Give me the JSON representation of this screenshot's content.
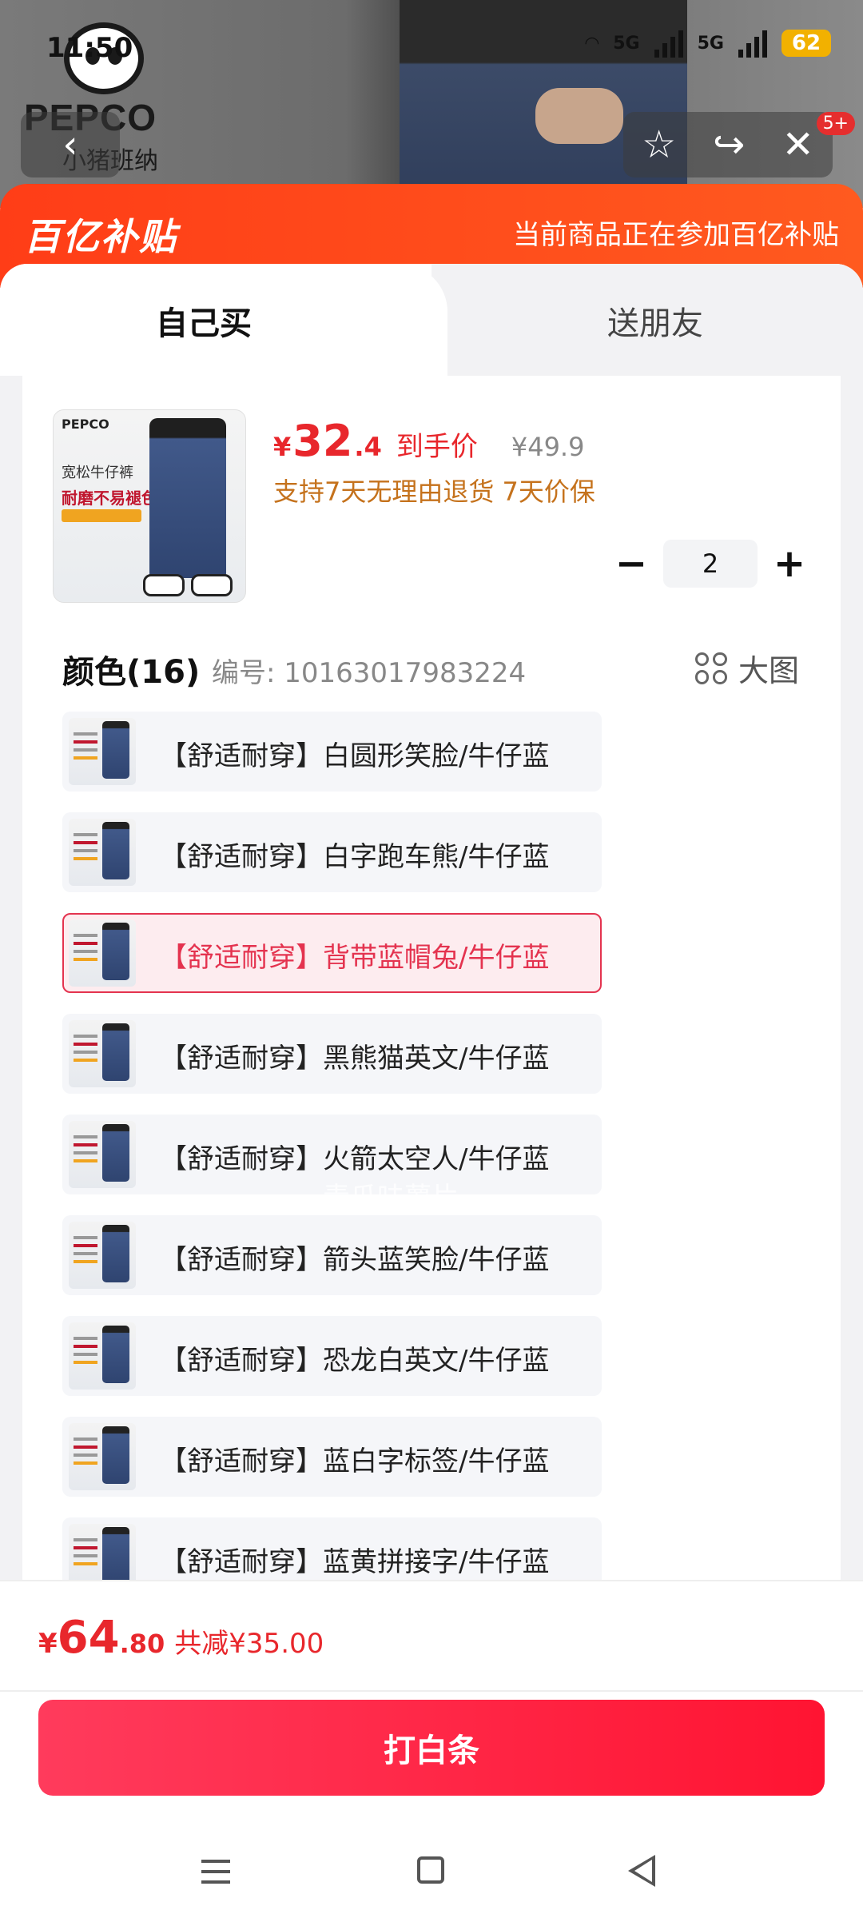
{
  "status_bar": {
    "time": "11:50",
    "signal_1": "5G",
    "signal_2": "5G",
    "battery": "62"
  },
  "background": {
    "brand": "PEPCO",
    "brand_cn": "小猪班纳",
    "notification_badge": "5+"
  },
  "banner": {
    "logo_text": "百亿补贴",
    "message": "当前商品正在参加百亿补贴"
  },
  "tabs": [
    {
      "label": "自己买",
      "active": true
    },
    {
      "label": "送朋友",
      "active": false
    }
  ],
  "product": {
    "thumb_brand": "PEPCO",
    "thumb_line1": "宽松牛仔裤",
    "thumb_line2": "耐磨不易褪色",
    "price_symbol": "¥",
    "price_integer": "32",
    "price_decimal": ".4",
    "price_label": "到手价",
    "original_price": "¥49.9",
    "services": "支持7天无理由退货 7天价保",
    "quantity": "2"
  },
  "colors": {
    "title": "颜色(16)",
    "code": "编号: 10163017983224",
    "big_pic_label": "大图",
    "selected_index": 2,
    "options": [
      "【舒适耐穿】白圆形笑脸/牛仔蓝",
      "【舒适耐穿】白字跑车熊/牛仔蓝",
      "【舒适耐穿】背带蓝帽兔/牛仔蓝",
      "【舒适耐穿】黑熊猫英文/牛仔蓝",
      "【舒适耐穿】火箭太空人/牛仔蓝",
      "【舒适耐穿】箭头蓝笑脸/牛仔蓝",
      "【舒适耐穿】恐龙白英文/牛仔蓝",
      "【舒适耐穿】蓝白字标签/牛仔蓝",
      "【舒适耐穿】蓝黄拼接字/牛仔蓝"
    ]
  },
  "watermark": "青瓜味薯片",
  "footer": {
    "total_symbol": "¥",
    "total_integer": "64",
    "total_decimal": ".80",
    "discount": "共减¥35.00",
    "cta_label": "打白条"
  },
  "colors_theme": {
    "accent": "#e8272c",
    "banner": "#ff3d17",
    "selected_border": "#e4334f"
  }
}
